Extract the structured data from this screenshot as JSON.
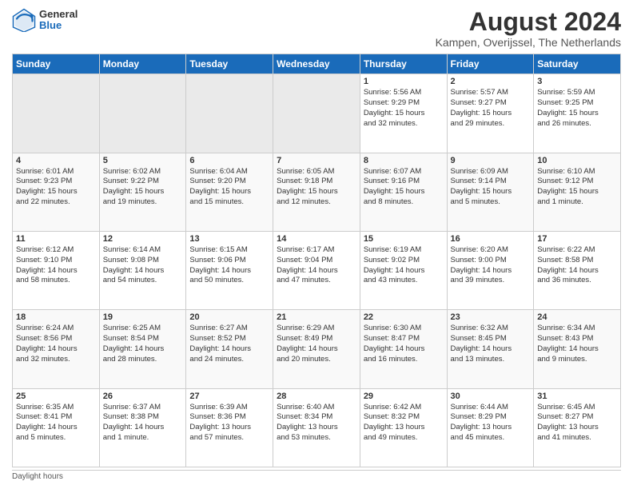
{
  "header": {
    "logo_general": "General",
    "logo_blue": "Blue",
    "main_title": "August 2024",
    "subtitle": "Kampen, Overijssel, The Netherlands"
  },
  "columns": [
    "Sunday",
    "Monday",
    "Tuesday",
    "Wednesday",
    "Thursday",
    "Friday",
    "Saturday"
  ],
  "footer_text": "Daylight hours",
  "weeks": [
    {
      "days": [
        {
          "num": "",
          "info": "",
          "empty": true
        },
        {
          "num": "",
          "info": "",
          "empty": true
        },
        {
          "num": "",
          "info": "",
          "empty": true
        },
        {
          "num": "",
          "info": "",
          "empty": true
        },
        {
          "num": "1",
          "info": "Sunrise: 5:56 AM\nSunset: 9:29 PM\nDaylight: 15 hours\nand 32 minutes."
        },
        {
          "num": "2",
          "info": "Sunrise: 5:57 AM\nSunset: 9:27 PM\nDaylight: 15 hours\nand 29 minutes."
        },
        {
          "num": "3",
          "info": "Sunrise: 5:59 AM\nSunset: 9:25 PM\nDaylight: 15 hours\nand 26 minutes."
        }
      ]
    },
    {
      "days": [
        {
          "num": "4",
          "info": "Sunrise: 6:01 AM\nSunset: 9:23 PM\nDaylight: 15 hours\nand 22 minutes."
        },
        {
          "num": "5",
          "info": "Sunrise: 6:02 AM\nSunset: 9:22 PM\nDaylight: 15 hours\nand 19 minutes."
        },
        {
          "num": "6",
          "info": "Sunrise: 6:04 AM\nSunset: 9:20 PM\nDaylight: 15 hours\nand 15 minutes."
        },
        {
          "num": "7",
          "info": "Sunrise: 6:05 AM\nSunset: 9:18 PM\nDaylight: 15 hours\nand 12 minutes."
        },
        {
          "num": "8",
          "info": "Sunrise: 6:07 AM\nSunset: 9:16 PM\nDaylight: 15 hours\nand 8 minutes."
        },
        {
          "num": "9",
          "info": "Sunrise: 6:09 AM\nSunset: 9:14 PM\nDaylight: 15 hours\nand 5 minutes."
        },
        {
          "num": "10",
          "info": "Sunrise: 6:10 AM\nSunset: 9:12 PM\nDaylight: 15 hours\nand 1 minute."
        }
      ]
    },
    {
      "days": [
        {
          "num": "11",
          "info": "Sunrise: 6:12 AM\nSunset: 9:10 PM\nDaylight: 14 hours\nand 58 minutes."
        },
        {
          "num": "12",
          "info": "Sunrise: 6:14 AM\nSunset: 9:08 PM\nDaylight: 14 hours\nand 54 minutes."
        },
        {
          "num": "13",
          "info": "Sunrise: 6:15 AM\nSunset: 9:06 PM\nDaylight: 14 hours\nand 50 minutes."
        },
        {
          "num": "14",
          "info": "Sunrise: 6:17 AM\nSunset: 9:04 PM\nDaylight: 14 hours\nand 47 minutes."
        },
        {
          "num": "15",
          "info": "Sunrise: 6:19 AM\nSunset: 9:02 PM\nDaylight: 14 hours\nand 43 minutes."
        },
        {
          "num": "16",
          "info": "Sunrise: 6:20 AM\nSunset: 9:00 PM\nDaylight: 14 hours\nand 39 minutes."
        },
        {
          "num": "17",
          "info": "Sunrise: 6:22 AM\nSunset: 8:58 PM\nDaylight: 14 hours\nand 36 minutes."
        }
      ]
    },
    {
      "days": [
        {
          "num": "18",
          "info": "Sunrise: 6:24 AM\nSunset: 8:56 PM\nDaylight: 14 hours\nand 32 minutes."
        },
        {
          "num": "19",
          "info": "Sunrise: 6:25 AM\nSunset: 8:54 PM\nDaylight: 14 hours\nand 28 minutes."
        },
        {
          "num": "20",
          "info": "Sunrise: 6:27 AM\nSunset: 8:52 PM\nDaylight: 14 hours\nand 24 minutes."
        },
        {
          "num": "21",
          "info": "Sunrise: 6:29 AM\nSunset: 8:49 PM\nDaylight: 14 hours\nand 20 minutes."
        },
        {
          "num": "22",
          "info": "Sunrise: 6:30 AM\nSunset: 8:47 PM\nDaylight: 14 hours\nand 16 minutes."
        },
        {
          "num": "23",
          "info": "Sunrise: 6:32 AM\nSunset: 8:45 PM\nDaylight: 14 hours\nand 13 minutes."
        },
        {
          "num": "24",
          "info": "Sunrise: 6:34 AM\nSunset: 8:43 PM\nDaylight: 14 hours\nand 9 minutes."
        }
      ]
    },
    {
      "days": [
        {
          "num": "25",
          "info": "Sunrise: 6:35 AM\nSunset: 8:41 PM\nDaylight: 14 hours\nand 5 minutes."
        },
        {
          "num": "26",
          "info": "Sunrise: 6:37 AM\nSunset: 8:38 PM\nDaylight: 14 hours\nand 1 minute."
        },
        {
          "num": "27",
          "info": "Sunrise: 6:39 AM\nSunset: 8:36 PM\nDaylight: 13 hours\nand 57 minutes."
        },
        {
          "num": "28",
          "info": "Sunrise: 6:40 AM\nSunset: 8:34 PM\nDaylight: 13 hours\nand 53 minutes."
        },
        {
          "num": "29",
          "info": "Sunrise: 6:42 AM\nSunset: 8:32 PM\nDaylight: 13 hours\nand 49 minutes."
        },
        {
          "num": "30",
          "info": "Sunrise: 6:44 AM\nSunset: 8:29 PM\nDaylight: 13 hours\nand 45 minutes."
        },
        {
          "num": "31",
          "info": "Sunrise: 6:45 AM\nSunset: 8:27 PM\nDaylight: 13 hours\nand 41 minutes."
        }
      ]
    }
  ]
}
